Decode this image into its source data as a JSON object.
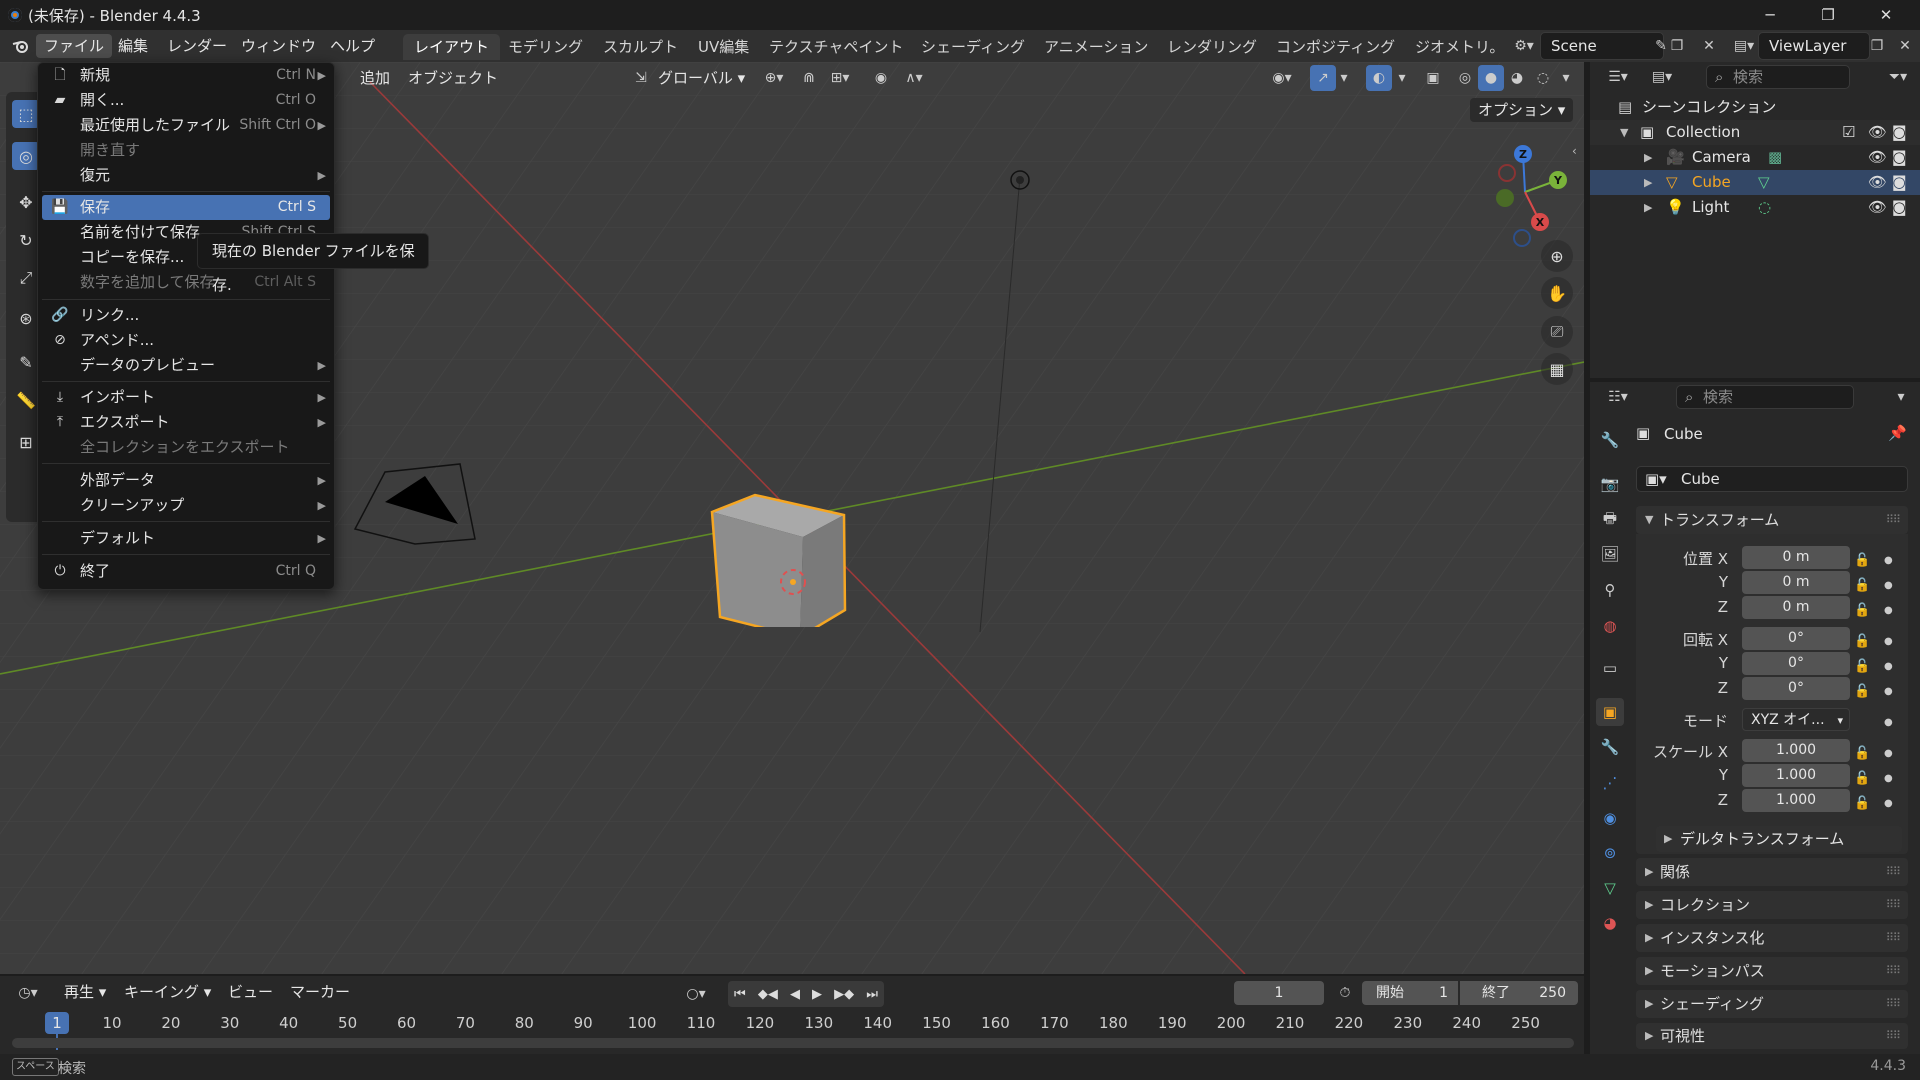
{
  "window": {
    "title": "(未保存) - Blender 4.4.3",
    "minimize": "─",
    "maximize": "❐",
    "close": "✕"
  },
  "menubar": {
    "file": "ファイル",
    "edit": "編集",
    "render": "レンダー",
    "window": "ウィンドウ",
    "help": "ヘルプ"
  },
  "workspaces": [
    "レイアウト",
    "モデリング",
    "スカルプト",
    "UV編集",
    "テクスチャペイント",
    "シェーディング",
    "アニメーション",
    "レンダリング",
    "コンポジティング",
    "ジオメトリ。"
  ],
  "scene": {
    "name": "Scene",
    "view_layer": "ViewLayer"
  },
  "viewport_header": {
    "add": "追加",
    "object": "オブジェクト",
    "orientation": "グローバル",
    "options": "オプション"
  },
  "file_menu": {
    "new": {
      "label": "新規",
      "shortcut": "Ctrl N"
    },
    "open": {
      "label": "開く...",
      "shortcut": "Ctrl O"
    },
    "recent": {
      "label": "最近使用したファイル",
      "shortcut": "Shift Ctrl O"
    },
    "revert": {
      "label": "開き直す"
    },
    "recover": {
      "label": "復元"
    },
    "save": {
      "label": "保存",
      "shortcut": "Ctrl S"
    },
    "save_as": {
      "label": "名前を付けて保存...",
      "shortcut": "Shift Ctrl S"
    },
    "save_copy": {
      "label": "コピーを保存..."
    },
    "save_incremental": {
      "label": "数字を追加して保存",
      "shortcut": "Ctrl Alt S"
    },
    "link": {
      "label": "リンク..."
    },
    "append": {
      "label": "アペンド..."
    },
    "data_previews": {
      "label": "データのプレビュー"
    },
    "import": {
      "label": "インポート"
    },
    "export": {
      "label": "エクスポート"
    },
    "export_all_collections": {
      "label": "全コレクションをエクスポート"
    },
    "external_data": {
      "label": "外部データ"
    },
    "cleanup": {
      "label": "クリーンアップ"
    },
    "defaults": {
      "label": "デフォルト"
    },
    "quit": {
      "label": "終了",
      "shortcut": "Ctrl Q"
    }
  },
  "tooltip": "現在の Blender ファイルを保存.",
  "gizmo": {
    "z": "Z",
    "y": "Y",
    "x": "X"
  },
  "outliner": {
    "search_placeholder": "検索",
    "scene_collection": "シーンコレクション",
    "collection": "Collection",
    "items": [
      {
        "name": "Camera",
        "color": "#e6a15c"
      },
      {
        "name": "Cube",
        "color": "#f5a623"
      },
      {
        "name": "Light",
        "color": "#e6a15c"
      }
    ]
  },
  "properties": {
    "search_placeholder": "検索",
    "object_name": "Cube",
    "datablock": "Cube",
    "transform_panel": "トランスフォーム",
    "location_label": "位置 X",
    "rotation_label": "回転 X",
    "scale_label": "スケール X",
    "y": "Y",
    "z": "Z",
    "location": [
      "0 m",
      "0 m",
      "0 m"
    ],
    "rotation": [
      "0°",
      "0°",
      "0°"
    ],
    "mode_label": "モード",
    "mode_value": "XYZ オイ...",
    "scale": [
      "1.000",
      "1.000",
      "1.000"
    ],
    "delta_transform": "デルタトランスフォーム",
    "panels": [
      "関係",
      "コレクション",
      "インスタンス化",
      "モーションパス",
      "シェーディング",
      "可視性"
    ]
  },
  "timeline": {
    "playback": "再生",
    "keying": "キーイング",
    "view": "ビュー",
    "marker": "マーカー",
    "current_frame": "1",
    "start_label": "開始",
    "start": "1",
    "end_label": "終了",
    "end": "250",
    "ruler": [
      "10",
      "20",
      "30",
      "40",
      "50",
      "60",
      "70",
      "80",
      "90",
      "100",
      "110",
      "120",
      "130",
      "140",
      "150",
      "160",
      "170",
      "180",
      "190",
      "200",
      "210",
      "220",
      "230",
      "240",
      "250"
    ],
    "playhead": "1"
  },
  "statusbar": {
    "key": "スペース",
    "action": "検索",
    "version": "4.4.3"
  },
  "colors": {
    "accent": "#4772b3",
    "selection": "#f5a623",
    "x_axis": "#b33a3a",
    "y_axis": "#6b9a2b"
  }
}
